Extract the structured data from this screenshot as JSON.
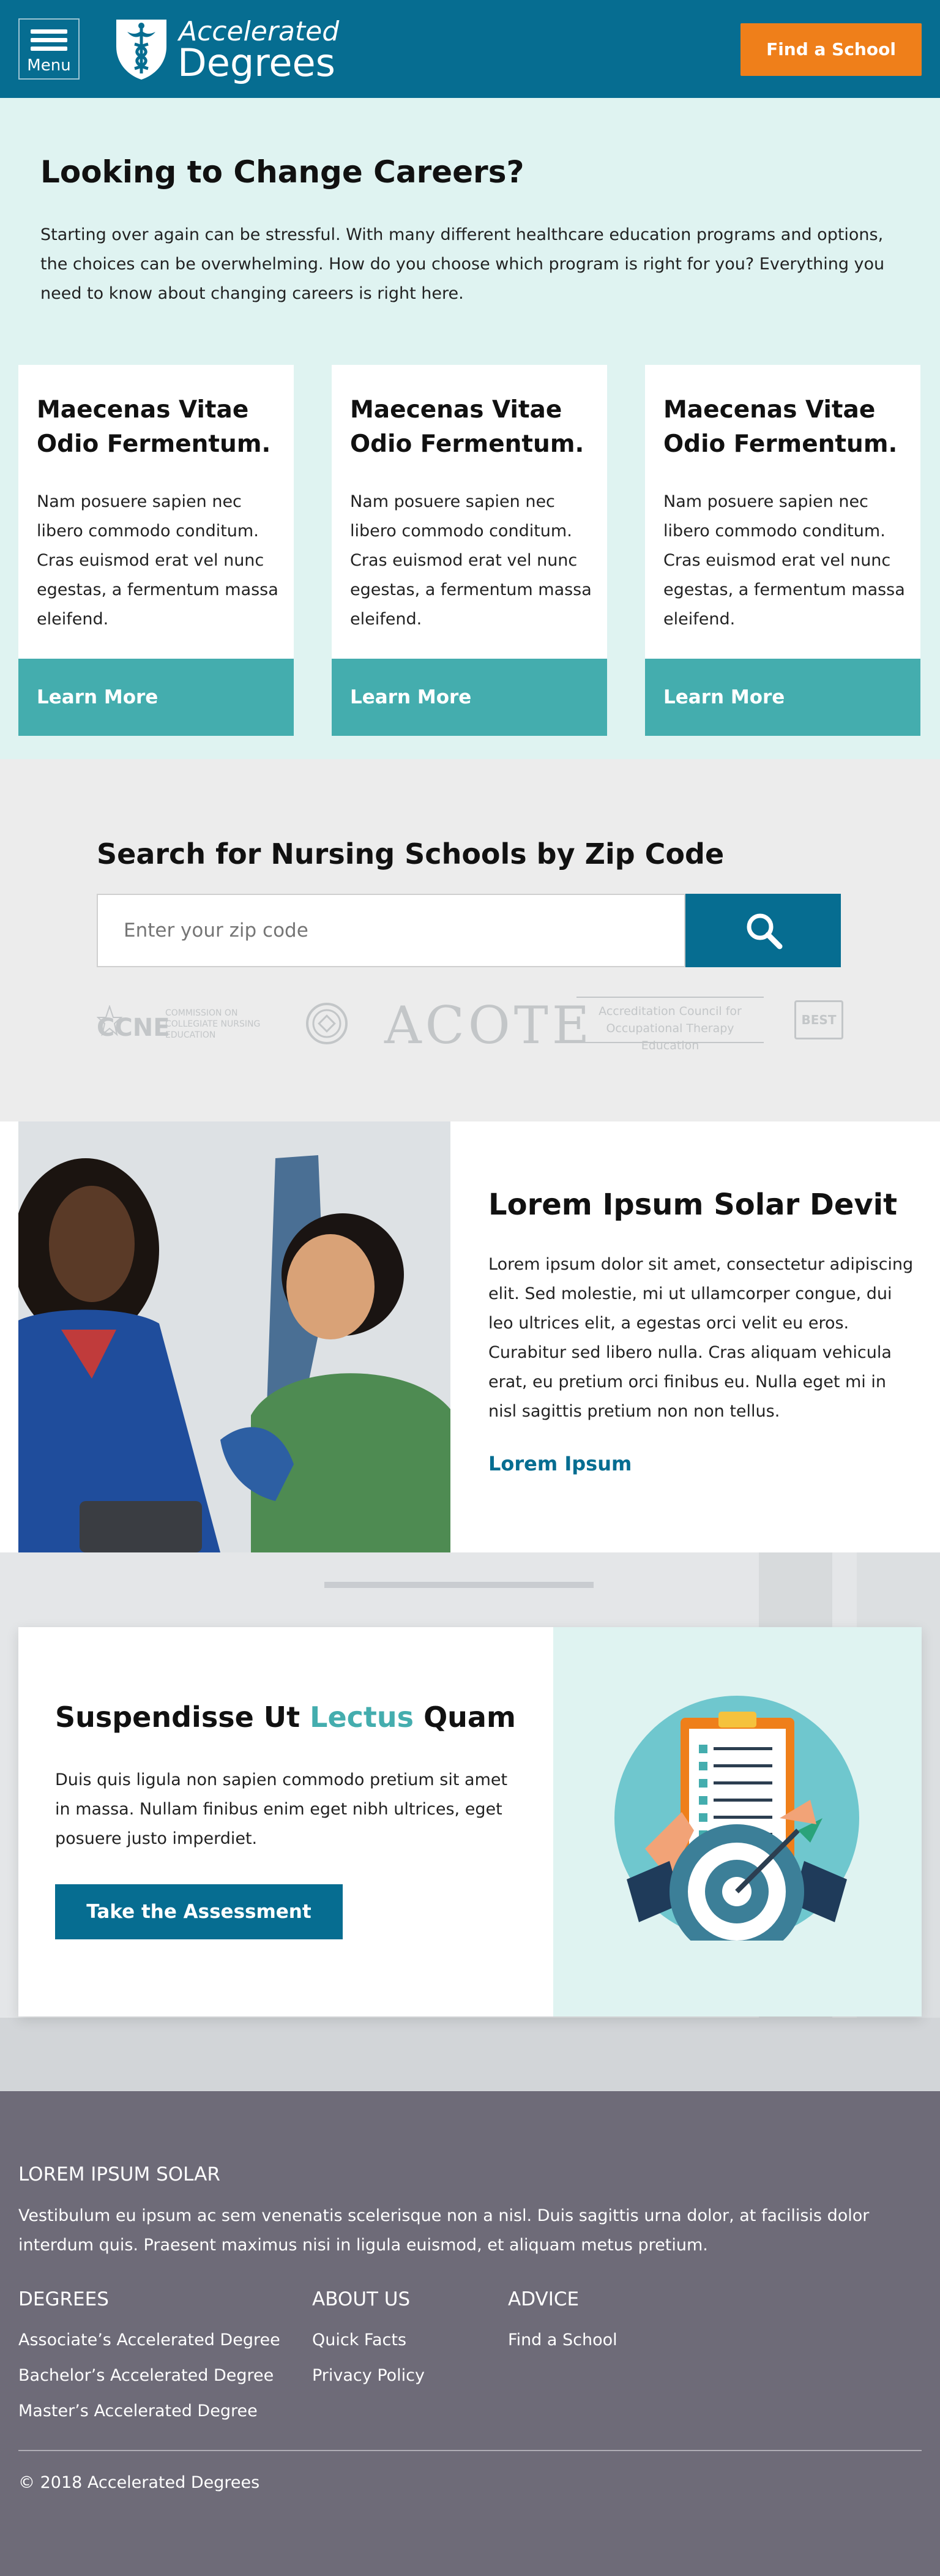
{
  "header": {
    "menu_label": "Menu",
    "logo_line1": "Accelerated",
    "logo_line2": "Degrees",
    "cta_label": "Find a School",
    "colors": {
      "header_bg": "#066d91",
      "cta_bg": "#ef7f1a"
    }
  },
  "hero": {
    "title": "Looking to Change Careers?",
    "intro": "Starting over again can be stressful. With many different healthcare education programs and options, the choices can be overwhelming. How do you choose which program is right for you? Everything you need to know about changing careers is right here.",
    "cards": [
      {
        "title": "Maecenas Vitae Odio Fermentum.",
        "body": "Nam posuere sapien nec libero commodo conditum. Cras euismod erat vel nunc egestas, a fermentum massa eleifend.",
        "cta": "Learn More"
      },
      {
        "title": "Maecenas Vitae Odio Fermentum.",
        "body": "Nam posuere sapien nec libero commodo conditum. Cras euismod erat vel nunc egestas, a fermentum massa eleifend.",
        "cta": "Learn More"
      },
      {
        "title": "Maecenas Vitae Odio Fermentum.",
        "body": "Nam posuere sapien nec libero commodo conditum. Cras euismod erat vel nunc egestas, a fermentum massa eleifend.",
        "cta": "Learn More"
      }
    ]
  },
  "search": {
    "title": "Search for Nursing Schools by Zip Code",
    "placeholder": "Enter your zip code",
    "button_icon": "search-icon",
    "accreditors": {
      "ccne_mark": "CCNE",
      "ccne_name": "COMMISSION ON COLLEGIATE NURSING EDUCATION",
      "acote_mark": "ACOTE",
      "acote_name": "Accreditation Council for Occupational Therapy Education",
      "badge_text": "BEST"
    }
  },
  "feature": {
    "title": "Lorem Ipsum Solar Devit",
    "body": "Lorem ipsum dolor sit amet, consectetur adipiscing elit. Sed molestie, mi ut ullamcorper congue, dui leo ultrices elit, a egestas orci velit eu eros. Curabitur sed libero nulla. Cras aliquam vehicula erat, eu pretium orci finibus eu. Nulla eget mi in nisl sagittis pretium non non tellus.",
    "link": "Lorem Ipsum"
  },
  "assessment": {
    "title_before": "Suspendisse Ut ",
    "title_highlight": "Lectus",
    "title_after": " Quam",
    "body": "Duis quis ligula non sapien commodo pretium sit amet in massa. Nullam finibus enim eget nibh ultrices, eget posuere justo imperdiet.",
    "cta": "Take the Assessment",
    "illustration_icon": "clipboard-target-icon"
  },
  "footer": {
    "title": "LOREM IPSUM SOLAR",
    "description": "Vestibulum eu ipsum ac sem venenatis scelerisque non a nisl. Duis sagittis urna dolor, at facilisis dolor interdum quis. Praesent maximus nisi in ligula euismod, et aliquam metus pretium.",
    "columns": [
      {
        "heading": "DEGREES",
        "links": [
          "Associate’s Accelerated Degree",
          "Bachelor’s Accelerated Degree",
          "Master’s Accelerated Degree"
        ]
      },
      {
        "heading": "ABOUT US",
        "links": [
          "Quick Facts",
          "Privacy Policy"
        ]
      },
      {
        "heading": "ADVICE",
        "links": [
          "Find a School"
        ]
      }
    ],
    "copyright": "© 2018 Accelerated Degrees"
  }
}
